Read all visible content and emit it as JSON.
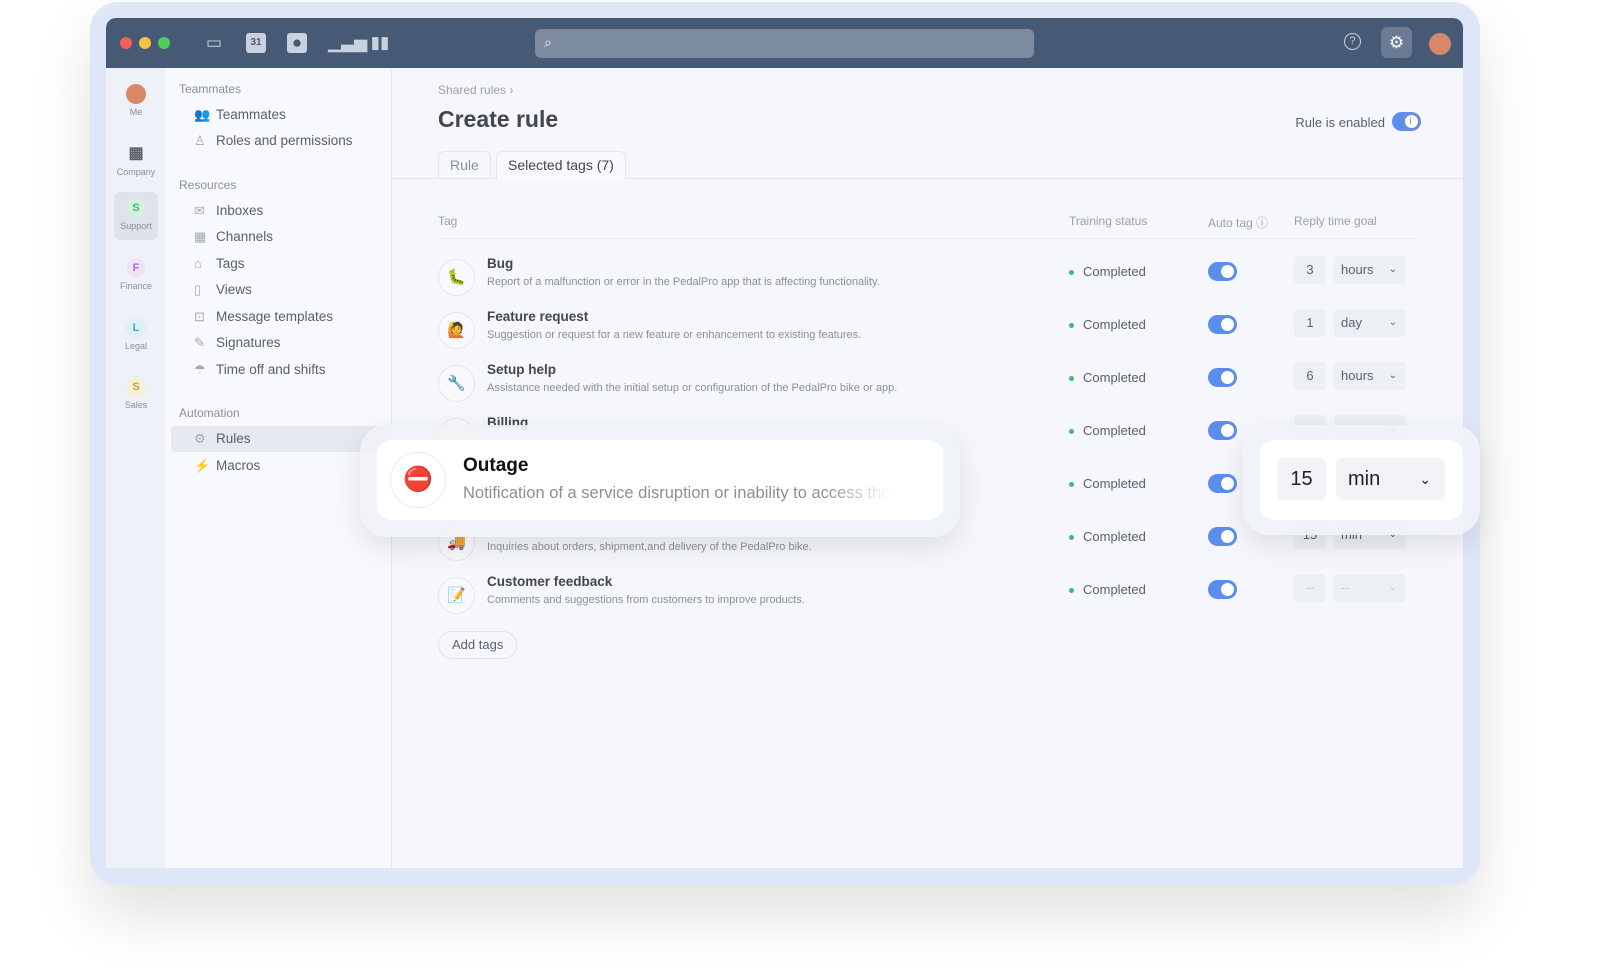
{
  "toolbar": {
    "icons": [
      "inbox-icon",
      "calendar-icon",
      "contacts-icon",
      "analytics-icon",
      "book-icon"
    ],
    "calendar_day": "31"
  },
  "rail": [
    {
      "label": "Me"
    },
    {
      "label": "Company"
    },
    {
      "label": "Support",
      "letter": "S",
      "color": "#3cbf6b"
    },
    {
      "label": "Finance",
      "letter": "F",
      "color": "#a66bd8"
    },
    {
      "label": "Legal",
      "letter": "L",
      "color": "#3aa8c9"
    },
    {
      "label": "Sales",
      "letter": "S",
      "color": "#c9a23a"
    }
  ],
  "sidebar": {
    "sections": [
      {
        "title": "Teammates",
        "items": [
          "Teammates",
          "Roles and permissions"
        ]
      },
      {
        "title": "Resources",
        "items": [
          "Inboxes",
          "Channels",
          "Tags",
          "Views",
          "Message templates",
          "Signatures",
          "Time off and shifts"
        ]
      },
      {
        "title": "Automation",
        "items": [
          "Rules",
          "Macros"
        ]
      }
    ],
    "active": "Rules"
  },
  "main": {
    "breadcrumb": "Shared rules",
    "breadcrumb_sep": "›",
    "title": "Create rule",
    "enabled_label": "Rule is enabled",
    "enabled": true,
    "tabs": [
      "Rule",
      "Selected tags (7)"
    ],
    "active_tab": "Selected tags (7)",
    "columns": [
      "Tag",
      "Training status",
      "Auto tag",
      "Reply time goal"
    ],
    "rows": [
      {
        "name": "Bug",
        "desc": "Report of a malfunction or error in the PedalPro app that is affecting functionality.",
        "status": "Completed",
        "auto": true,
        "num": "3",
        "unit": "hours",
        "icon": "🐛"
      },
      {
        "name": "Feature request",
        "desc": "Suggestion or request for a new feature or enhancement to existing features.",
        "status": "Completed",
        "auto": true,
        "num": "1",
        "unit": "day",
        "icon": "🙋"
      },
      {
        "name": "Setup help",
        "desc": "Assistance needed with the initial setup or configuration of the PedalPro bike or app.",
        "status": "Completed",
        "auto": true,
        "num": "6",
        "unit": "hours",
        "icon": "🔧"
      },
      {
        "name": "Billing",
        "desc": "",
        "status": "Completed",
        "auto": true,
        "num": "",
        "unit": "",
        "icon": ""
      },
      {
        "name": "",
        "desc": "",
        "status": "Completed",
        "auto": true,
        "num": "",
        "unit": "",
        "icon": ""
      },
      {
        "name": "",
        "desc": "Inquiries about orders, shipment,and delivery of the PedalPro bike.",
        "status": "Completed",
        "auto": true,
        "num": "15",
        "unit": "min",
        "icon": "🚚"
      },
      {
        "name": "Customer feedback",
        "desc": "Comments and suggestions from customers to improve products.",
        "status": "Completed",
        "auto": true,
        "num": "--",
        "unit": "--",
        "icon": "📝"
      }
    ],
    "add_tags": "Add tags"
  },
  "popover_tag": {
    "name": "Outage",
    "desc": "Notification of a service disruption or inability to access the",
    "icon": "⛔"
  },
  "popover_goal": {
    "num": "15",
    "unit": "min"
  }
}
